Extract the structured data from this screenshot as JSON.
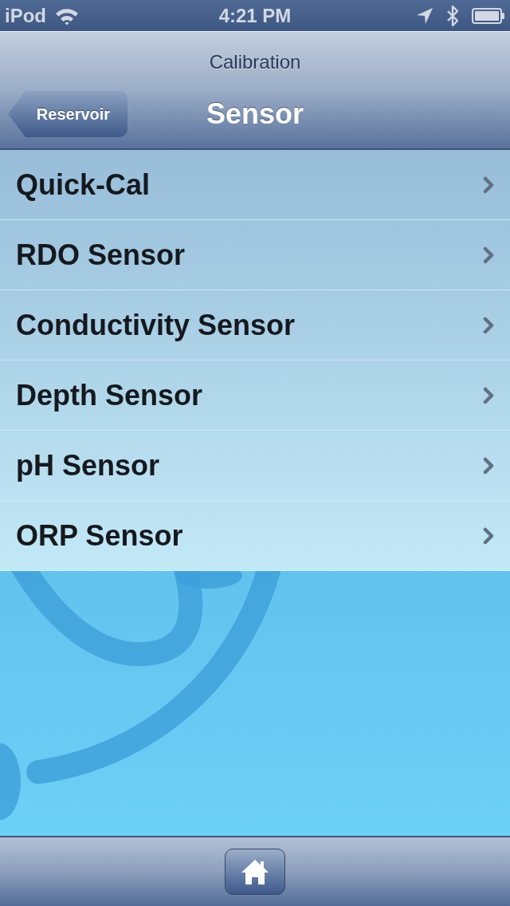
{
  "status_bar": {
    "carrier": "iPod",
    "time": "4:21 PM"
  },
  "nav_bar": {
    "prompt": "Calibration",
    "back_button": "Reservoir",
    "title": "Sensor"
  },
  "list": {
    "items": [
      {
        "label": "Quick-Cal"
      },
      {
        "label": "RDO Sensor"
      },
      {
        "label": "Conductivity Sensor"
      },
      {
        "label": "Depth Sensor"
      },
      {
        "label": "pH Sensor"
      },
      {
        "label": "ORP Sensor"
      }
    ]
  }
}
